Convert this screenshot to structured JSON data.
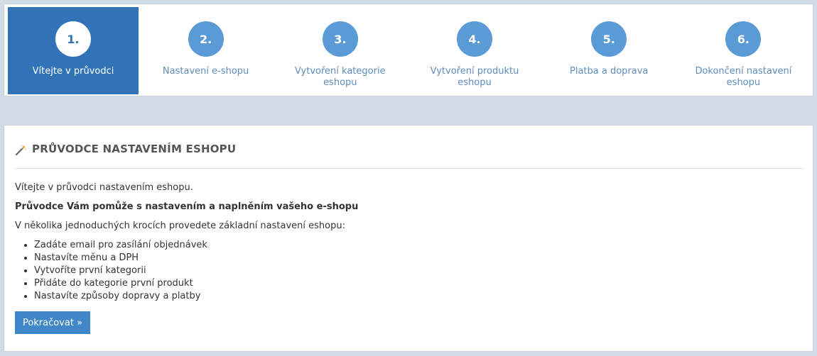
{
  "wizard": {
    "steps": [
      {
        "number": "1.",
        "label": "Vítejte v průvodci",
        "active": true
      },
      {
        "number": "2.",
        "label": "Nastavení e-shopu",
        "active": false
      },
      {
        "number": "3.",
        "label": "Vytvoření kategorie eshopu",
        "active": false
      },
      {
        "number": "4.",
        "label": "Vytvoření produktu eshopu",
        "active": false
      },
      {
        "number": "5.",
        "label": "Platba a doprava",
        "active": false
      },
      {
        "number": "6.",
        "label": "Dokončení nastavení eshopu",
        "active": false
      }
    ]
  },
  "panel": {
    "icon": "magic-wand-icon",
    "title": "PRŮVODCE NASTAVENÍM ESHOPU",
    "intro": "Vítejte v průvodci nastavením eshopu.",
    "bold_text": "Průvodce Vám pomůže s nastavením a naplněním vašeho e-shopu",
    "steps_intro": "V několika jednoduchých krocích provedete základní nastavení eshopu:",
    "items": [
      "Zadáte email pro zasílání objednávek",
      "Nastavíte měnu a DPH",
      "Vytvoříte první kategorii",
      "Přidáte do kategorie první produkt",
      "Nastavíte způsoby dopravy a platby"
    ],
    "continue_label": "Pokračovat »"
  },
  "colors": {
    "active_step_bg": "#3273b8",
    "circle": "#5b9bd5",
    "step_label": "#5d8dbd",
    "button": "#3f87c8",
    "page_bg": "#d2dbe6"
  }
}
